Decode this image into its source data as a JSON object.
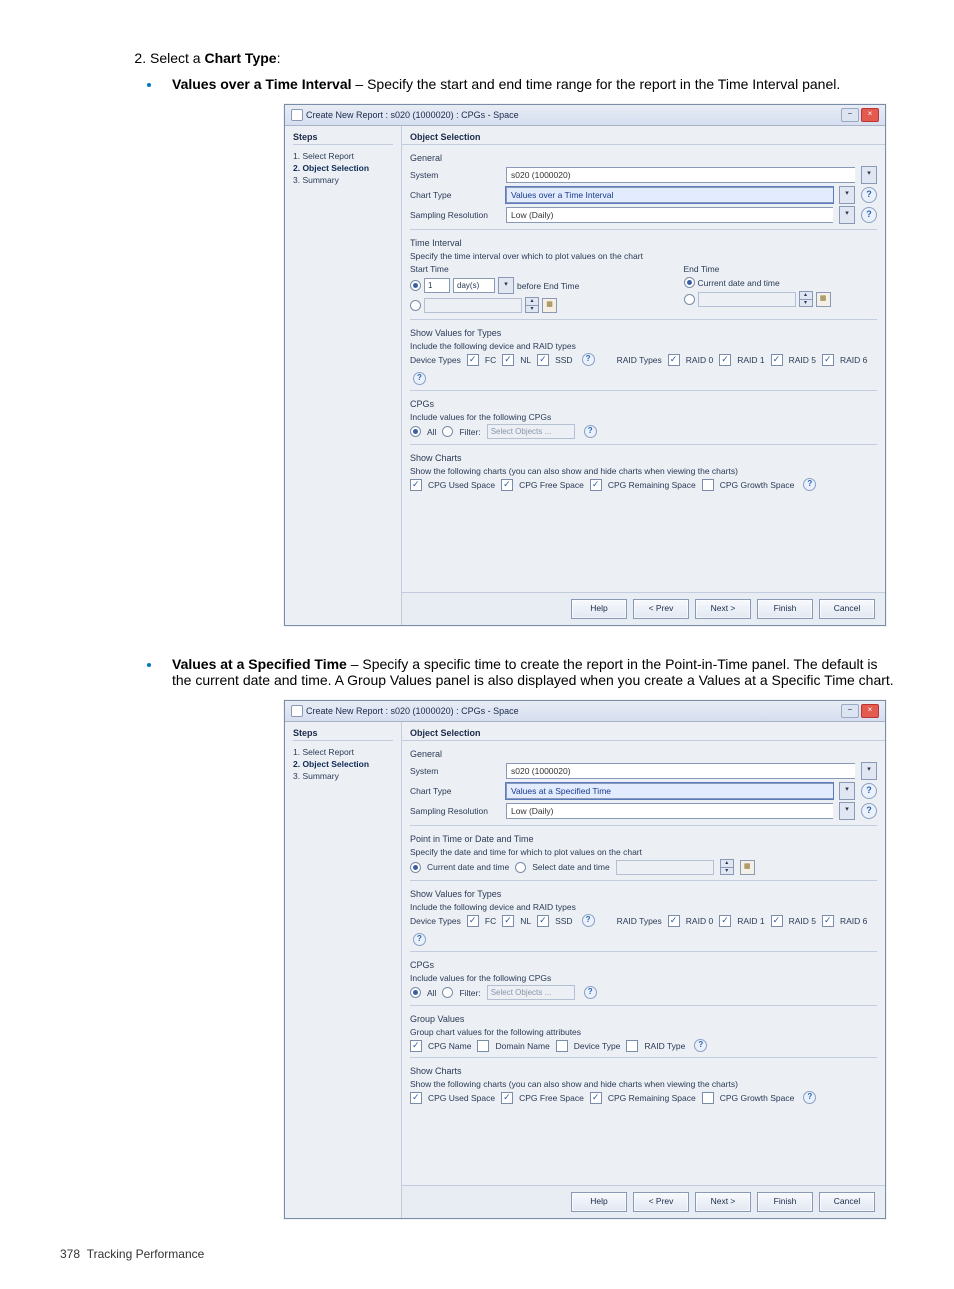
{
  "instruction_number": "2.",
  "instruction_prefix": "Select a ",
  "instruction_bold": "Chart Type",
  "instruction_suffix": ":",
  "bullet1_title": "Values over a Time Interval",
  "bullet1_text": " – Specify the start and end time range for the report in the Time Interval panel.",
  "bullet2_title": "Values at a Specified Time",
  "bullet2_text": " – Specify a specific time to create the report in the Point-in-Time panel. The default is the current date and time. A Group Values panel is also displayed when you create a Values at a Specific Time chart.",
  "dialog": {
    "title": "Create New Report : s020 (1000020) : CPGs - Space",
    "steps_header": "Steps",
    "steps": [
      "1. Select Report",
      "2. Object Selection",
      "3. Summary"
    ],
    "object_selection_header": "Object Selection",
    "general_label": "General",
    "system_label": "System",
    "system_value": "s020 (1000020)",
    "chart_type_label": "Chart Type",
    "chart_type_value_1": "Values over a Time Interval",
    "chart_type_value_2": "Values at a Specified Time",
    "sampling_label": "Sampling Resolution",
    "sampling_value": "Low (Daily)",
    "time_interval_label": "Time Interval",
    "time_interval_desc": "Specify the time interval over which to plot values on the chart",
    "start_time_label": "Start Time",
    "end_time_label": "End Time",
    "start_value": "1",
    "days_label": "day(s)",
    "before_end_label": "before End Time",
    "current_date_label": "Current date and time",
    "pit_label": "Point in Time or Date and Time",
    "pit_desc": "Specify the date and time for which to plot values on the chart",
    "select_date_label": "Select date and time",
    "show_values_label": "Show Values for Types",
    "show_values_desc": "Include the following device and RAID types",
    "device_types_label": "Device Types",
    "device_fc": "FC",
    "device_nl": "NL",
    "device_ssd": "SSD",
    "raid_types_label": "RAID Types",
    "raid0": "RAID 0",
    "raid1": "RAID 1",
    "raid5": "RAID 5",
    "raid6": "RAID 6",
    "cpgs_label": "CPGs",
    "cpgs_desc": "Include values for the following CPGs",
    "all_label": "All",
    "filter_label": "Filter:",
    "select_objects": "Select Objects ...",
    "group_values_label": "Group Values",
    "group_values_desc": "Group chart values for the following attributes",
    "gv_cpg_name": "CPG Name",
    "gv_domain_name": "Domain Name",
    "gv_device_type": "Device Type",
    "gv_raid_type": "RAID Type",
    "show_charts_label": "Show Charts",
    "show_charts_desc": "Show the following charts (you can also show and hide charts when viewing the charts)",
    "sc_used": "CPG Used Space",
    "sc_free": "CPG Free Space",
    "sc_remaining": "CPG Remaining Space",
    "sc_growth": "CPG Growth Space",
    "help_btn": "Help",
    "prev_btn": "< Prev",
    "next_btn": "Next >",
    "finish_btn": "Finish",
    "cancel_btn": "Cancel"
  },
  "footer_page": "378",
  "footer_text": "Tracking Performance"
}
